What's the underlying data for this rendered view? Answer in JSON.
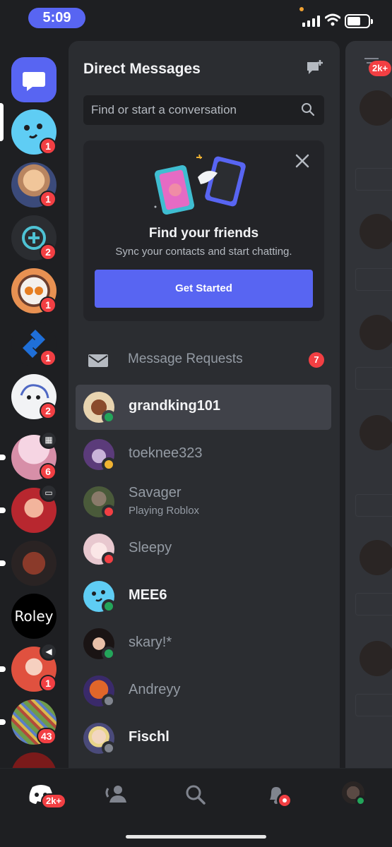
{
  "status_bar": {
    "time": "5:09"
  },
  "rail": {
    "servers": [
      {
        "name": "direct-messages",
        "badge": ""
      },
      {
        "name": "blue-smiley-server",
        "badge": "1"
      },
      {
        "name": "anime-server",
        "badge": "1"
      },
      {
        "name": "plus-server",
        "badge": "2"
      },
      {
        "name": "robot-server",
        "badge": "1"
      },
      {
        "name": "arrow-server",
        "badge": "1"
      },
      {
        "name": "sketch-server",
        "badge": "2"
      },
      {
        "name": "snowflake-server",
        "badge": "6"
      },
      {
        "name": "red-character-server",
        "badge": ""
      },
      {
        "name": "dragon-server",
        "badge": ""
      },
      {
        "name": "roley-server",
        "label": "Roley",
        "badge": ""
      },
      {
        "name": "redhair-server",
        "badge": "1"
      },
      {
        "name": "collage-server",
        "badge": "43"
      }
    ]
  },
  "dm_panel": {
    "title": "Direct Messages",
    "search_placeholder": "Find or start a conversation",
    "card": {
      "title": "Find your friends",
      "subtitle": "Sync your contacts and start chatting.",
      "button": "Get Started"
    },
    "message_requests": {
      "label": "Message Requests",
      "count": "7"
    },
    "dms": [
      {
        "name": "grandking101",
        "status": "online",
        "activity": ""
      },
      {
        "name": "toeknee323",
        "status": "idle",
        "activity": ""
      },
      {
        "name": "Savager",
        "status": "dnd",
        "activity": "Playing Roblox"
      },
      {
        "name": "Sleepy",
        "status": "dnd",
        "activity": ""
      },
      {
        "name": "MEE6",
        "status": "online",
        "activity": ""
      },
      {
        "name": "skary!*",
        "status": "online",
        "activity": ""
      },
      {
        "name": "Andreyy",
        "status": "offline",
        "activity": ""
      },
      {
        "name": "Fischl",
        "status": "offline",
        "activity": ""
      }
    ]
  },
  "peek": {
    "badge": "2k+"
  },
  "bottom_nav": {
    "home_badge": "2k+",
    "items": [
      "home",
      "friends",
      "search",
      "notifications",
      "you"
    ]
  },
  "colors": {
    "accent": "#5865f2",
    "danger": "#f23f43",
    "online": "#23a55a",
    "idle": "#f0b232"
  }
}
